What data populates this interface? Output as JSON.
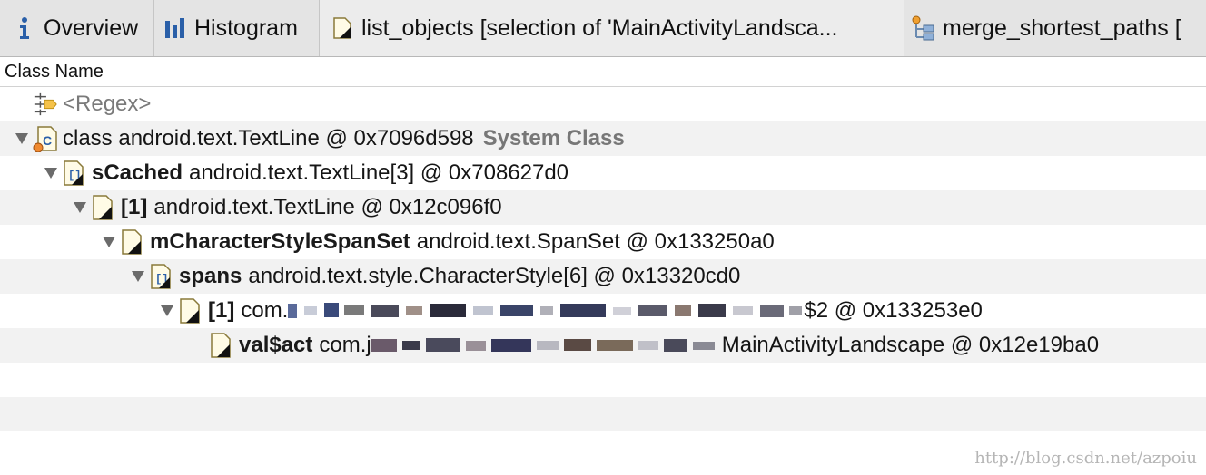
{
  "tabs": [
    {
      "label": "Overview",
      "icon": "info-icon"
    },
    {
      "label": "Histogram",
      "icon": "histogram-icon"
    },
    {
      "label": "list_objects [selection of 'MainActivityLandsca...",
      "icon": "object-icon"
    },
    {
      "label": "merge_shortest_paths [",
      "icon": "tree-graph-icon"
    }
  ],
  "column_header": "Class Name",
  "rows": {
    "regex": {
      "label": "<Regex>"
    },
    "r1": {
      "prefix": "",
      "text": "class android.text.TextLine @ 0x7096d598",
      "badge": "System Class"
    },
    "r2": {
      "prefix": "sCached",
      "text": "android.text.TextLine[3] @ 0x708627d0"
    },
    "r3": {
      "prefix": "[1]",
      "text": "android.text.TextLine @ 0x12c096f0"
    },
    "r4": {
      "prefix": "mCharacterStyleSpanSet",
      "text": "android.text.SpanSet @ 0x133250a0"
    },
    "r5": {
      "prefix": "spans",
      "text": "android.text.style.CharacterStyle[6] @ 0x13320cd0"
    },
    "r6": {
      "prefix": "[1]",
      "text_start": "com.",
      "text_end": "$2 @ 0x133253e0"
    },
    "r7": {
      "prefix": "val$act",
      "text_start": "com.j",
      "text_end": "MainActivityLandscape @ 0x12e19ba0"
    }
  },
  "watermark": "http://blog.csdn.net/azpoiu",
  "colors": {
    "row_alt": "#f2f2f2",
    "tab_bar": "#e4e4e4",
    "system_class": "#777777",
    "icon_blue": "#2a5fa8"
  }
}
